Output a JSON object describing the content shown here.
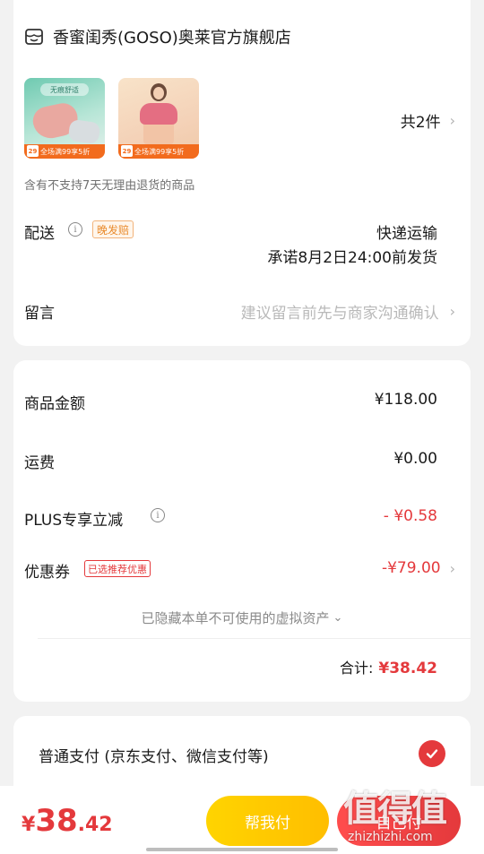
{
  "shop": {
    "icon": "store-icon",
    "name": "香蜜闺秀(GOSO)奥莱官方旗舰店",
    "products": [
      {
        "tag": "无痕舒适",
        "day": "29",
        "banner": "全场满99享5折"
      },
      {
        "tag": "",
        "day": "29",
        "banner": "全场满99享5折"
      }
    ],
    "item_count": "共2件",
    "return_note": "含有不支持7天无理由退货的商品"
  },
  "delivery": {
    "label": "配送",
    "late_badge": "晚发赔",
    "method": "快递运输",
    "promise": "承诺8月2日24:00前发货"
  },
  "message": {
    "label": "留言",
    "placeholder": "建议留言前先与商家沟通确认"
  },
  "price": {
    "goods_label": "商品金额",
    "goods_value": "¥118.00",
    "shipping_label": "运费",
    "shipping_value": "¥0.00",
    "plus_label": "PLUS专享立减",
    "plus_value": "- ¥0.58",
    "coupon_label": "优惠券",
    "coupon_badge": "已选推荐优惠",
    "coupon_value": "-¥79.00",
    "hidden_note": "已隐藏本单不可使用的虚拟资产",
    "total_label": "合计:",
    "total_value": "¥38.42"
  },
  "payment": {
    "method": "普通支付 (京东支付、微信支付等)",
    "selected": true
  },
  "bottom": {
    "currency": "¥",
    "amount_int": "38",
    "amount_dec": ".42",
    "help_pay": "帮我付",
    "self_pay": "自己付"
  },
  "watermark": {
    "text": "值得值",
    "url": "zhizhizhi.com"
  },
  "colors": {
    "accent_red": "#e4393c",
    "help_yellow": "#ffc800",
    "badge_orange": "#e98a2b"
  }
}
